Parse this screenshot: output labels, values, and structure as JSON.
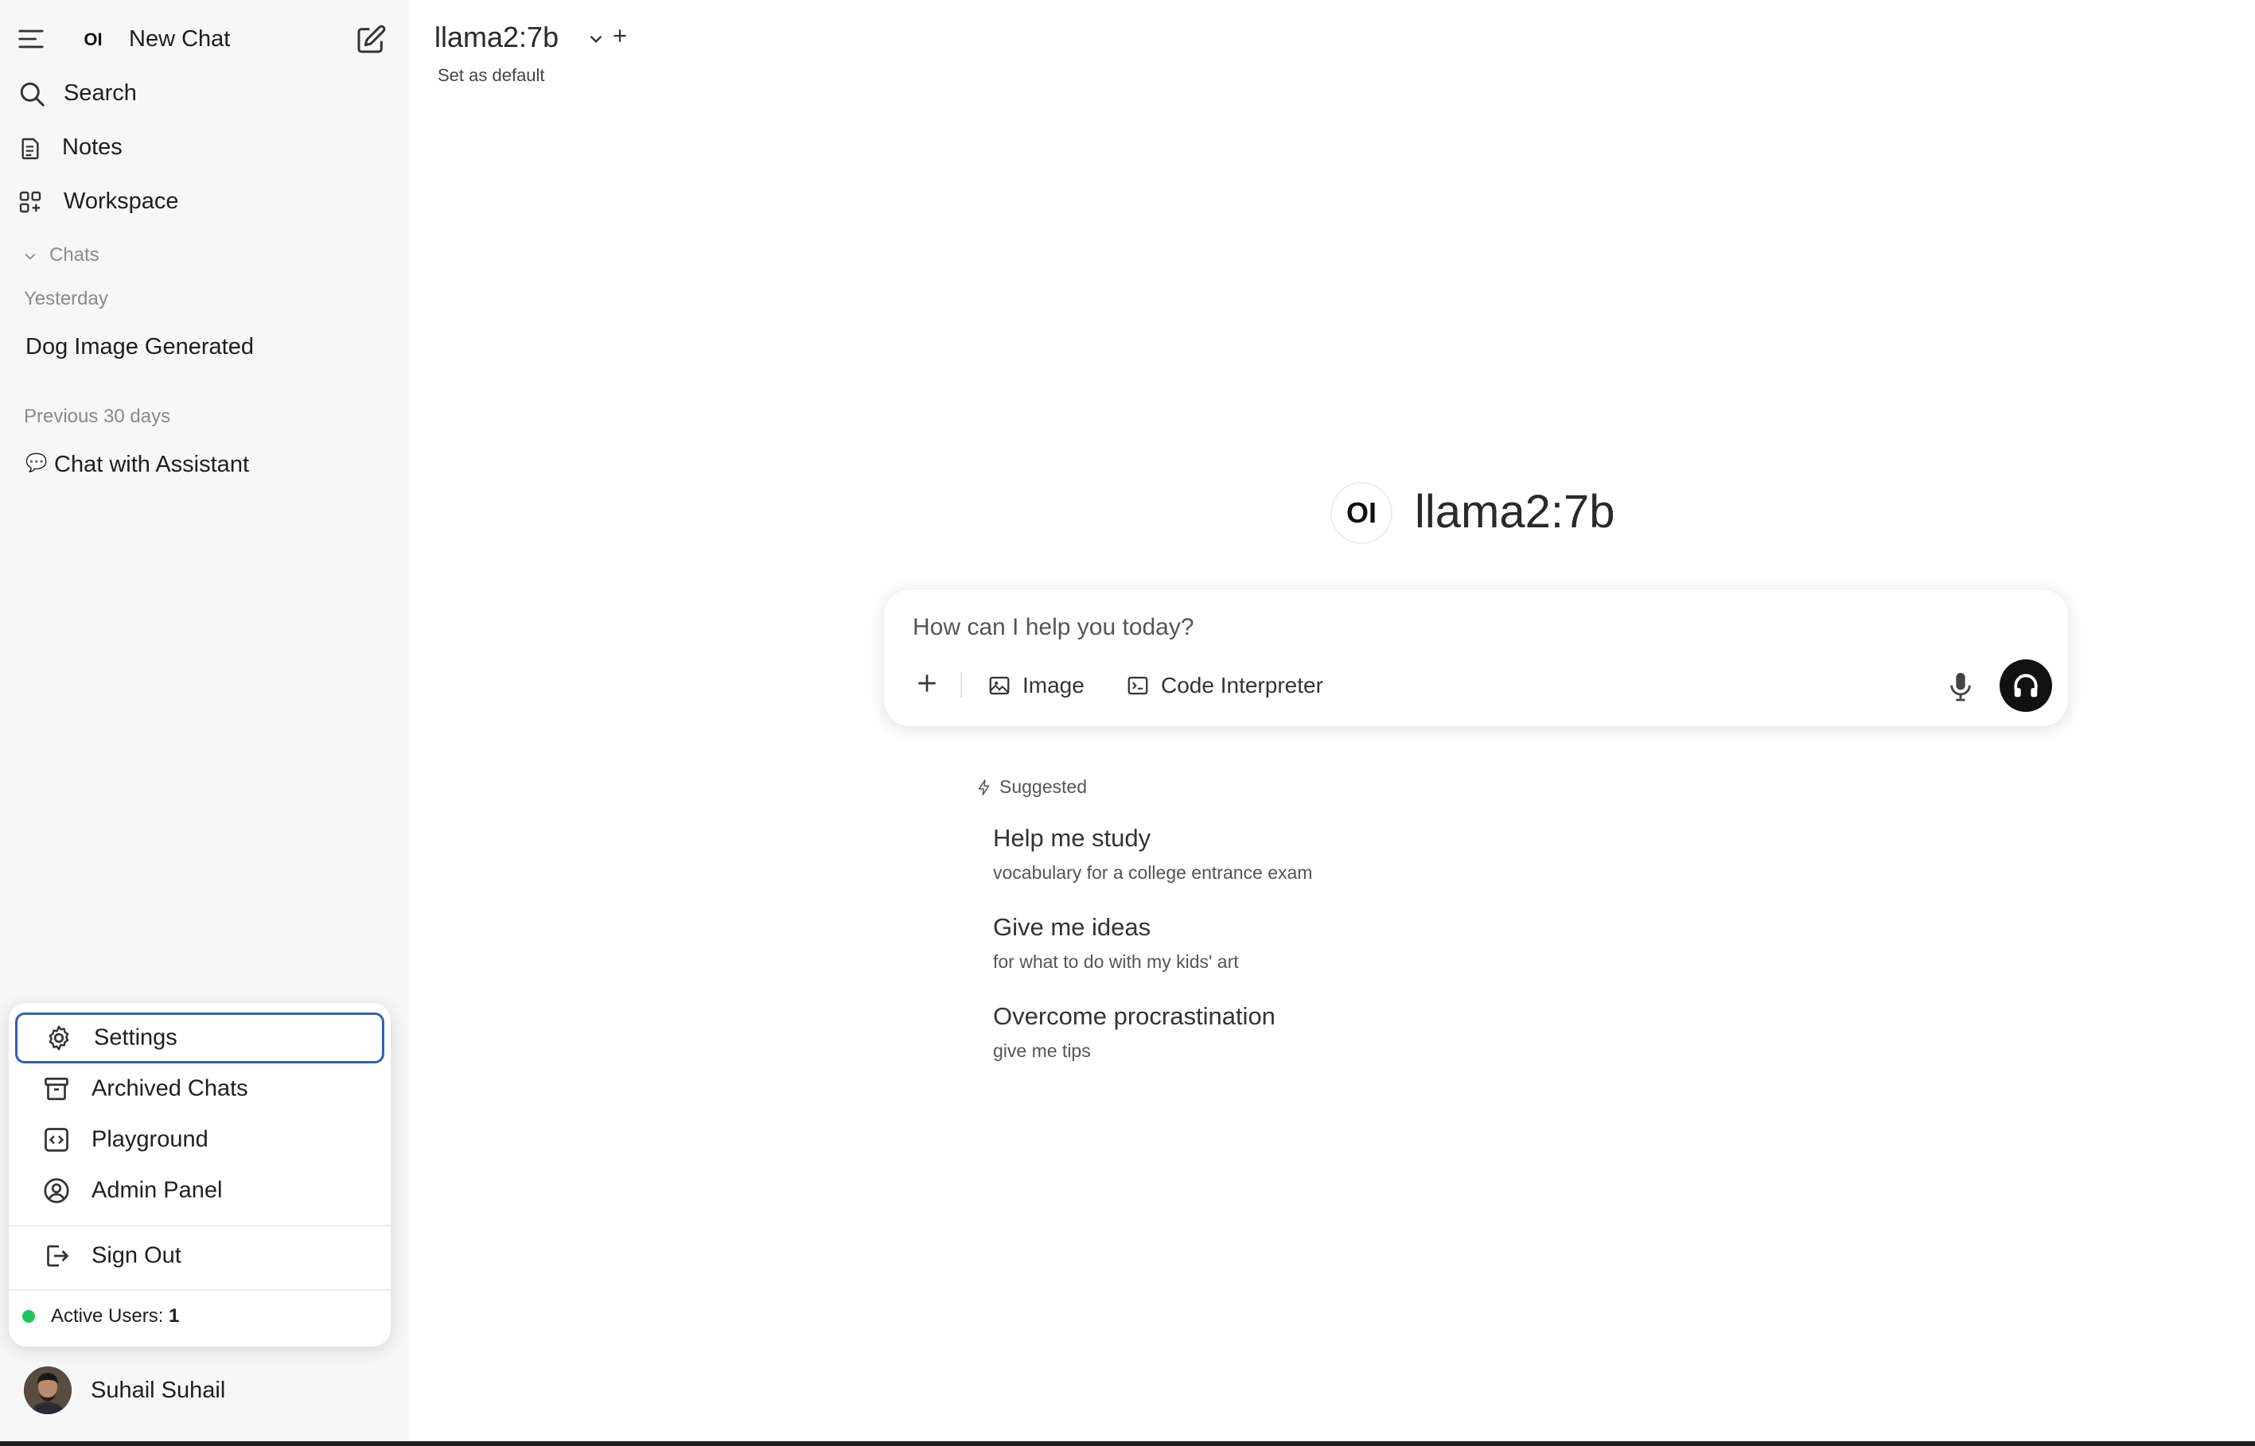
{
  "sidebar": {
    "brand_mark": "OI",
    "new_chat_label": "New Chat",
    "search_label": "Search",
    "notes_label": "Notes",
    "workspace_label": "Workspace",
    "chats_section_label": "Chats",
    "groups": [
      {
        "label": "Yesterday",
        "items": [
          {
            "title": "Dog Image Generated"
          }
        ]
      },
      {
        "label": "Previous 30 days",
        "items": [
          {
            "emoji": "💬",
            "title": "Chat with Assistant"
          }
        ]
      }
    ]
  },
  "user_menu": {
    "items": [
      {
        "label": "Settings",
        "icon": "gear-icon",
        "focused": true
      },
      {
        "label": "Archived Chats",
        "icon": "archive-icon"
      },
      {
        "label": "Playground",
        "icon": "code-icon"
      },
      {
        "label": "Admin Panel",
        "icon": "user-circle-icon"
      }
    ],
    "sign_out_label": "Sign Out",
    "active_users_label": "Active Users:",
    "active_users_count": "1",
    "status_color": "#22c55e"
  },
  "user": {
    "name": "Suhail Suhail"
  },
  "header": {
    "model_name": "llama2:7b",
    "set_default_label": "Set as default"
  },
  "hero": {
    "logo_text": "OI",
    "model_name": "llama2:7b"
  },
  "composer": {
    "placeholder": "How can I help you today?",
    "image_label": "Image",
    "code_interpreter_label": "Code Interpreter"
  },
  "suggested": {
    "header": "Suggested",
    "items": [
      {
        "title": "Help me study",
        "subtitle": "vocabulary for a college entrance exam"
      },
      {
        "title": "Give me ideas",
        "subtitle": "for what to do with my kids' art"
      },
      {
        "title": "Overcome procrastination",
        "subtitle": "give me tips"
      }
    ]
  },
  "colors": {
    "sidebar_bg": "#f7f7f7",
    "focus_ring": "#2f62b3",
    "voice_button": "#111111"
  }
}
